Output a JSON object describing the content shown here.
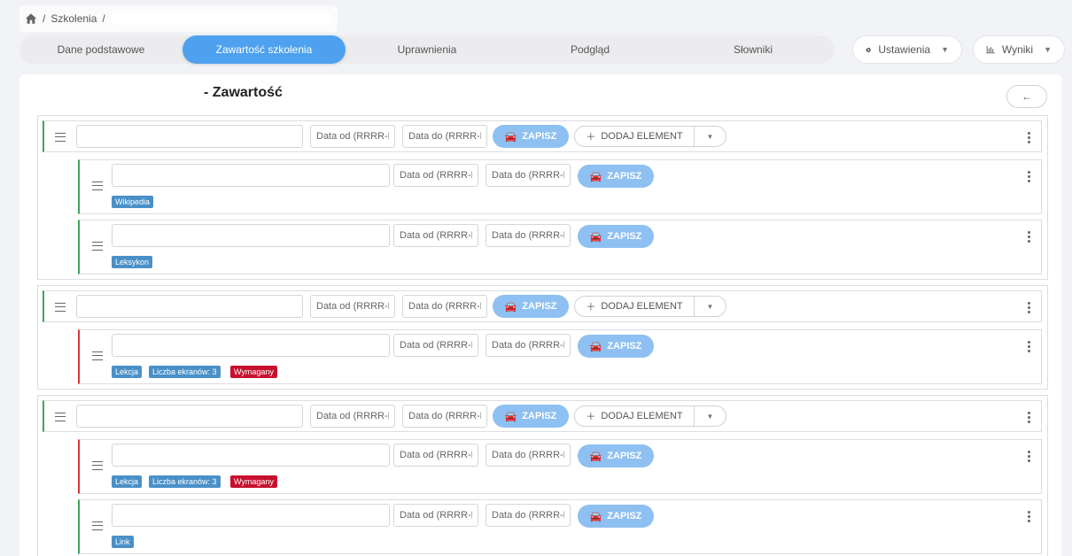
{
  "breadcrumb": {
    "separator": "/",
    "items": [
      "Szkolenia"
    ]
  },
  "tabs": [
    {
      "label": "Dane podstawowe",
      "active": false
    },
    {
      "label": "Zawartość szkolenia",
      "active": true
    },
    {
      "label": "Uprawnienia",
      "active": false
    },
    {
      "label": "Podgląd",
      "active": false
    },
    {
      "label": "Słowniki",
      "active": false
    }
  ],
  "settings_button": {
    "label": "Ustawienia",
    "icon": "gear-icon"
  },
  "results_button": {
    "label": "Wyniki",
    "icon": "bar-chart-icon"
  },
  "page": {
    "title": "- Zawartość",
    "back_icon": "arrow-left-icon"
  },
  "common": {
    "date_from_placeholder": "Data od (RRRR-MM-DD)",
    "date_to_placeholder": "Data do (RRRR-MM-DD)",
    "save_label": "ZAPISZ",
    "add_element_label": "DODAJ ELEMENT"
  },
  "groups": [
    {
      "title_value": "",
      "children": [
        {
          "value": "",
          "border": "green",
          "badges": [
            {
              "text": "Wikipedia",
              "color": "#4a90c8"
            }
          ]
        },
        {
          "value": "",
          "border": "green",
          "badges": [
            {
              "text": "Leksykon",
              "color": "#4a90c8"
            }
          ]
        }
      ]
    },
    {
      "title_value": "",
      "children": [
        {
          "value": "",
          "border": "red",
          "badges": [
            {
              "text": "Lekcja",
              "color": "#4a90c8"
            },
            {
              "text": "Liczba ekranów: 3",
              "color": "#4a90c8"
            },
            {
              "text": "Wymagany",
              "color": "#c8102e"
            }
          ]
        }
      ]
    },
    {
      "title_value": "",
      "children": [
        {
          "value": "",
          "border": "red",
          "badges": [
            {
              "text": "Lekcja",
              "color": "#4a90c8"
            },
            {
              "text": "Liczba ekranów: 3",
              "color": "#4a90c8"
            },
            {
              "text": "Wymagany",
              "color": "#c8102e"
            }
          ]
        },
        {
          "value": "",
          "border": "green",
          "badges": [
            {
              "text": "Link",
              "color": "#4a90c8"
            }
          ]
        }
      ]
    }
  ],
  "colors": {
    "accent": "#4ea1ee",
    "save": "#8ec0f2",
    "green_border": "#3da35d",
    "red_border": "#d9363e"
  }
}
